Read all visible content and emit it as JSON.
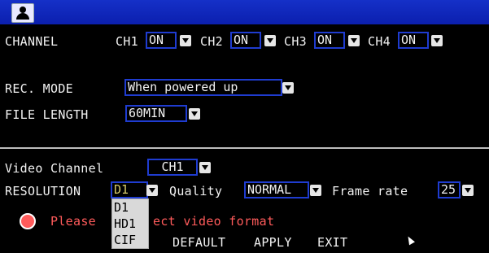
{
  "channel": {
    "label": "CHANNEL",
    "items": [
      {
        "name": "CH1",
        "value": "ON"
      },
      {
        "name": "CH2",
        "value": "ON"
      },
      {
        "name": "CH3",
        "value": "ON"
      },
      {
        "name": "CH4",
        "value": "ON"
      }
    ]
  },
  "rec_mode": {
    "label": "REC. MODE",
    "value": "When powered up"
  },
  "file_length": {
    "label": "FILE LENGTH",
    "value": "60MIN"
  },
  "video_channel": {
    "label": "Video Channel",
    "value": "CH1"
  },
  "resolution": {
    "label": "RESOLUTION",
    "value": "D1",
    "options": [
      "D1",
      "HD1",
      "CIF"
    ]
  },
  "quality": {
    "label": "Quality",
    "value": "NORMAL"
  },
  "frame_rate": {
    "label": "Frame rate",
    "value": "25"
  },
  "status": {
    "prefix": "Please",
    "suffix": "ect video format"
  },
  "buttons": {
    "default": "DEFAULT",
    "apply": "APPLY",
    "exit": "EXIT"
  }
}
